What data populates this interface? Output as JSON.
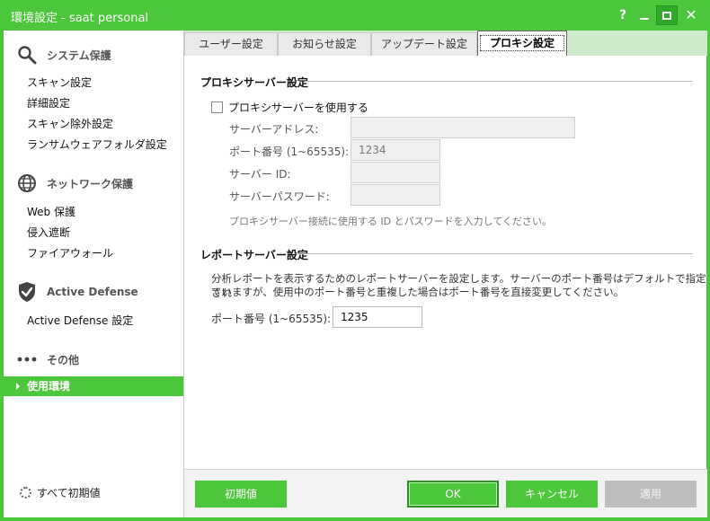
{
  "window": {
    "title": "環境設定 - saat personal",
    "help_label": "?",
    "close_label": "✕"
  },
  "sidebar": {
    "sections": [
      {
        "title": "システム保護",
        "icon": "magnifier-icon",
        "items": [
          "スキャン設定",
          "詳細設定",
          "スキャン除外設定",
          "ランサムウェアフォルダ設定"
        ]
      },
      {
        "title": "ネットワーク保護",
        "icon": "globe-icon",
        "items": [
          "Web 保護",
          "侵入遮断",
          "ファイアウォール"
        ]
      },
      {
        "title": "Active Defense",
        "icon": "shield-check-icon",
        "items": [
          "Active Defense 設定"
        ]
      },
      {
        "title": "その他",
        "icon": "ellipsis-icon",
        "items": [
          "使用環境"
        ]
      }
    ],
    "active_item": "使用環境",
    "reset_all_label": "すべて初期値"
  },
  "tabs": [
    {
      "label": "ユーザー設定",
      "active": false
    },
    {
      "label": "お知らせ設定",
      "active": false
    },
    {
      "label": "アップデート設定",
      "active": false
    },
    {
      "label": "プロキシ設定",
      "active": true
    }
  ],
  "proxy": {
    "group_title": "プロキシサーバー設定",
    "use_proxy_label": "プロキシサーバーを使用する",
    "use_proxy_checked": false,
    "address_label": "サーバーアドレス:",
    "address_value": "",
    "port_label": "ポート番号 (1~65535):",
    "port_value": "1234",
    "id_label": "サーバー ID:",
    "id_value": "",
    "password_label": "サーバーパスワード:",
    "password_value": "",
    "hint": "プロキシサーバー接続に使用する ID とパスワードを入力してください。"
  },
  "report": {
    "group_title": "レポートサーバー設定",
    "description_line1": "分析レポートを表示するためのレポートサーバーを設定します。サーバーのポート番号はデフォルトで指定され",
    "description_line2": "ていますが、使用中のポート番号と重複した場合はポート番号を直接変更してください。",
    "port_label": "ポート番号 (1~65535):",
    "port_value": "1235"
  },
  "footer": {
    "reset_label": "初期値",
    "ok_label": "OK",
    "cancel_label": "キャンセル",
    "apply_label": "適用"
  },
  "colors": {
    "accent": "#4cc63a",
    "disabled": "#bdbdbd"
  }
}
